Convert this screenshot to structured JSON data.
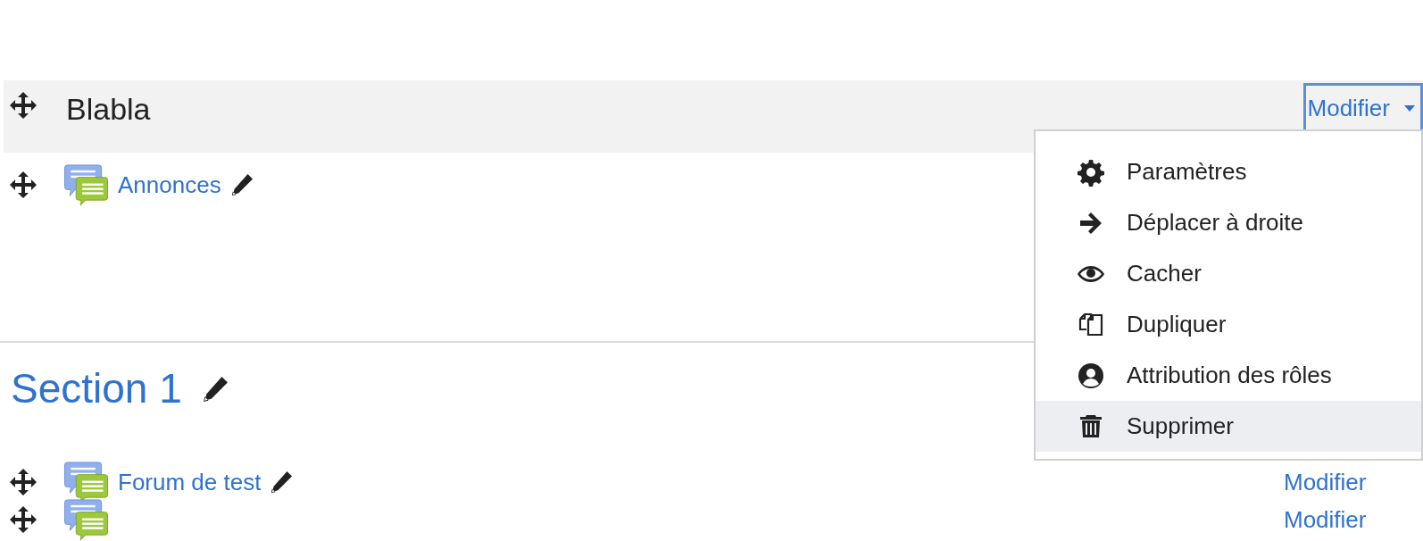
{
  "sections": [
    {
      "title": "Blabla",
      "kind": "header",
      "edit_button": {
        "label": "Modifier",
        "focused": true
      },
      "activities": [
        {
          "name": "Annonces"
        }
      ]
    },
    {
      "title": "Section 1",
      "kind": "titled",
      "activities": [
        {
          "name": "Forum de test",
          "edit_link": "Modifier"
        },
        {
          "edit_link": "Modifier"
        }
      ]
    }
  ],
  "menu": {
    "items": [
      {
        "label": "Paramètres",
        "selected": false
      },
      {
        "label": "Déplacer à droite",
        "selected": false
      },
      {
        "label": "Cacher",
        "selected": false
      },
      {
        "label": "Dupliquer",
        "selected": false
      },
      {
        "label": "Attribution des rôles",
        "selected": false
      },
      {
        "label": "Supprimer",
        "selected": true
      }
    ]
  }
}
